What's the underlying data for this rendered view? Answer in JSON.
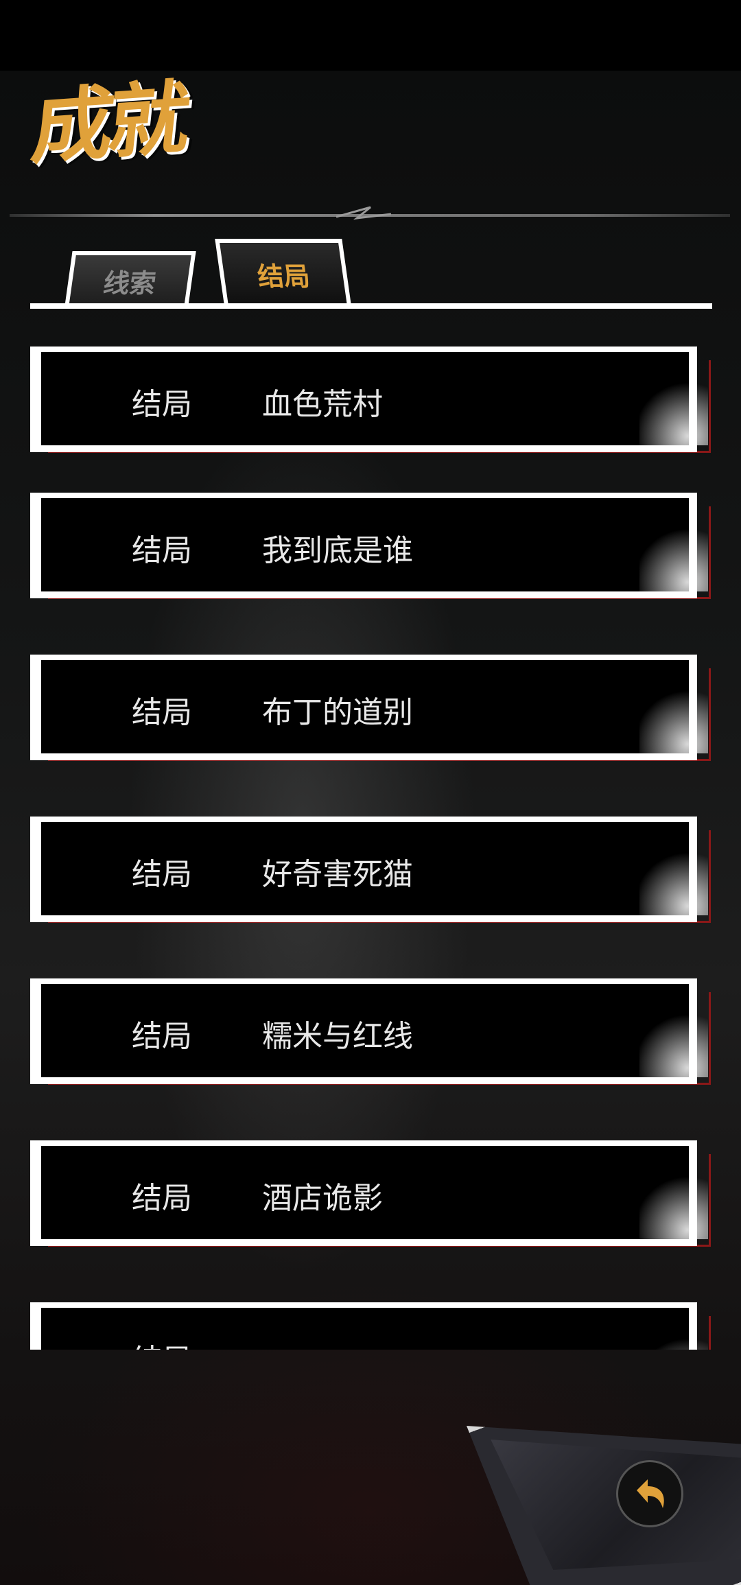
{
  "header": {
    "title": "成就"
  },
  "tabs": [
    {
      "label": "线索",
      "active": false
    },
    {
      "label": "结局",
      "active": true
    }
  ],
  "entries": [
    {
      "type": "结局",
      "name": "血色荒村"
    },
    {
      "type": "结局",
      "name": "我到底是谁"
    },
    {
      "type": "结局",
      "name": "布丁的道别"
    },
    {
      "type": "结局",
      "name": "好奇害死猫"
    },
    {
      "type": "结局",
      "name": "糯米与红线"
    },
    {
      "type": "结局",
      "name": "酒店诡影"
    },
    {
      "type": "结局",
      "name": ""
    }
  ],
  "colors": {
    "accent": "#e0a13a",
    "card_shadow": "#8b1818",
    "card": "#000000",
    "frame": "#ffffff"
  },
  "icons": {
    "back": "back-arrow-icon"
  }
}
